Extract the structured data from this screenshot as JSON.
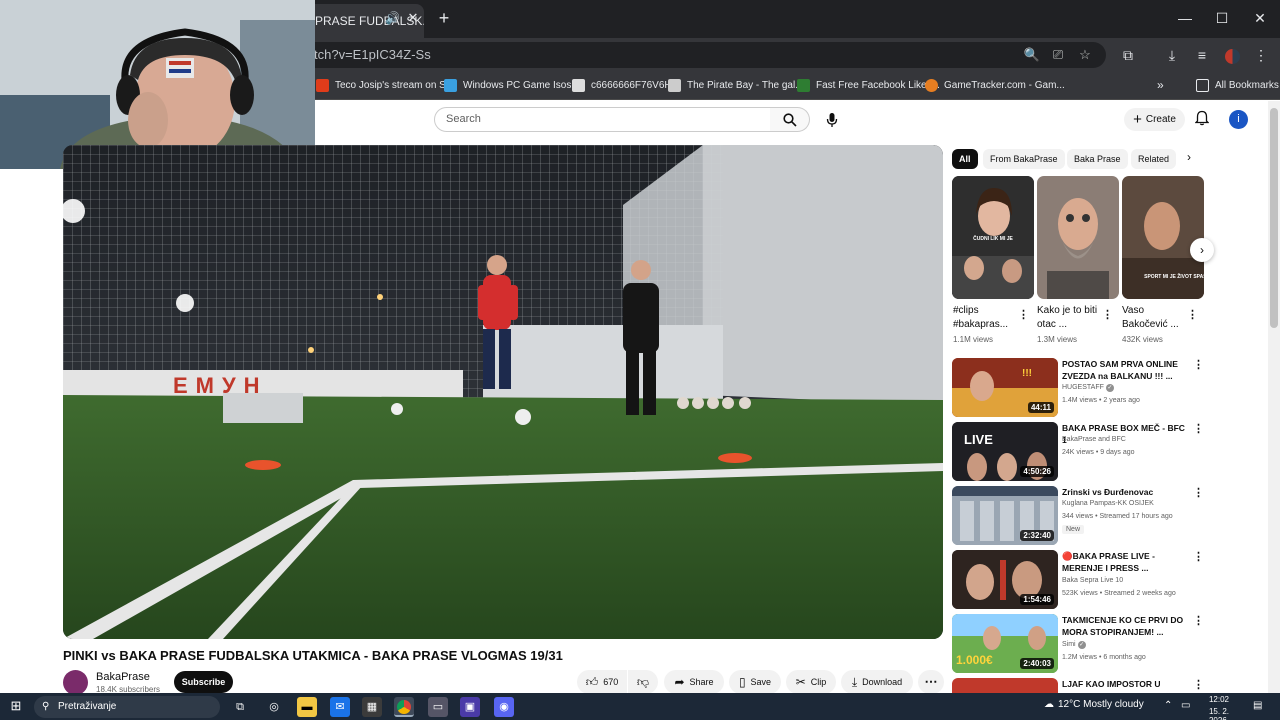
{
  "browser": {
    "active_tab_title": "PRASE FUDBALSK...",
    "url": "tch?v=E1pIC34Z-Ss",
    "bookmarks": [
      {
        "label": "Teco Josip's stream on S...",
        "color": "#e03c1a"
      },
      {
        "label": "Windows PC Game Isos...",
        "color": "#3aa0e0"
      },
      {
        "label": "c6666666F76V6H",
        "color": "#dddddd"
      },
      {
        "label": "The Pirate Bay - The gal...",
        "color": "#cccccc"
      },
      {
        "label": "Fast Free Facebook Likes...",
        "color": "#2e7d32"
      },
      {
        "label": "GameTracker.com - Gam...",
        "color": "#e67e22"
      }
    ],
    "all_bookmarks_label": "All Bookmarks"
  },
  "header": {
    "search_placeholder": "Search",
    "create_label": "Create",
    "avatar_letter": "i"
  },
  "video": {
    "title": "PINKI vs BAKA PRASE FUDBALSKA UTAKMICA - BAKA PRASE VLOGMAS 19/31",
    "channel": "BakaPrase",
    "subscribers": "18.4K subscribers",
    "subscribe_label": "Subscribe",
    "likes": "670",
    "share_label": "Share",
    "save_label": "Save",
    "clip_label": "Clip",
    "download_label": "Download",
    "banner_text": "ЕМУН"
  },
  "chips": [
    "All",
    "From BakaPrase",
    "Baka Prase",
    "Related"
  ],
  "shorts": [
    {
      "title": "#clips #bakapras...",
      "views": "1.1M views",
      "caption": "ČUDNI LIK MI JE",
      "color": "#3a3a3a"
    },
    {
      "title": "Kako je to biti otac ...",
      "views": "1.3M views",
      "caption": "",
      "color": "#8b7d75"
    },
    {
      "title": "Vaso Bakočević ...",
      "views": "432K views",
      "caption": "SPORT MI JE ŽIVOT SPASIO",
      "color": "#5c4a3e"
    }
  ],
  "recommended": [
    {
      "title": "POSTAO SAM PRVA ONLINE ZVEZDA na BALKANU !!! ...",
      "channel": "HUGESTAFF",
      "verified": true,
      "meta": "1.4M views • 2 years ago",
      "duration": "44:11",
      "badge": "",
      "color": "#b5432b"
    },
    {
      "title": "BAKA PRASE BOX MEČ - BFC 1",
      "channel": "BakaPrase and BFC",
      "verified": false,
      "meta": "24K views • 9 days ago",
      "duration": "4:50:26",
      "badge": "",
      "color": "#2a2a2a"
    },
    {
      "title": "Zrinski vs Đurđenovac",
      "channel": "Kuglana Pampas-KK OSIJEK",
      "verified": false,
      "meta": "344 views • Streamed 17 hours ago",
      "duration": "2:32:40",
      "badge": "New",
      "color": "#7d8a99"
    },
    {
      "title": "🔴BAKA PRASE LIVE - MERENJE I PRESS ...",
      "channel": "Baka Sepra Live 10",
      "verified": false,
      "meta": "523K views • Streamed 2 weeks ago",
      "duration": "1:54:46",
      "badge": "",
      "color": "#3d2f2a"
    },
    {
      "title": "TAKMICENJE KO CE PRVI DO MORA STOPIRANJEM! ...",
      "channel": "Simi",
      "verified": true,
      "meta": "1.2M views • 6 months ago",
      "duration": "2:40:03",
      "badge": "",
      "color": "#4f8f3a"
    },
    {
      "title": "LJAF KAO IMPOSTOR U",
      "channel": "",
      "verified": false,
      "meta": "",
      "duration": "",
      "badge": "",
      "color": "#c0392b"
    }
  ],
  "taskbar": {
    "search_placeholder": "Pretraživanje",
    "weather": "12°C  Mostly cloudy",
    "time": "12:02",
    "date": "15. 2. 2026."
  }
}
